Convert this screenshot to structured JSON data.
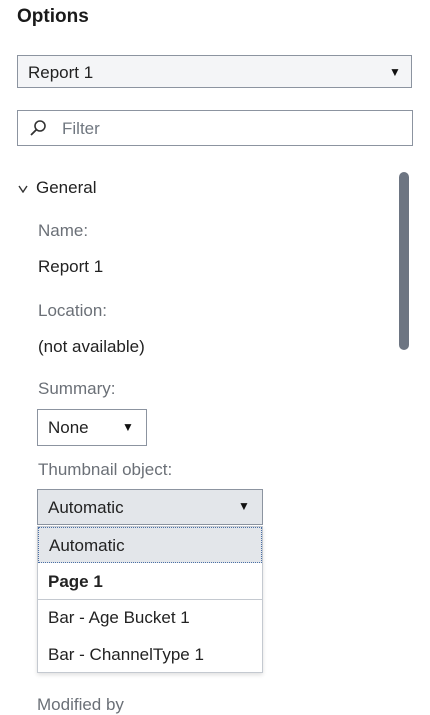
{
  "panel": {
    "title": "Options"
  },
  "report_select": {
    "value": "Report 1"
  },
  "filter": {
    "placeholder": "Filter"
  },
  "general": {
    "header": "General",
    "name_label": "Name:",
    "name_value": "Report 1",
    "location_label": "Location:",
    "location_value": "(not available)",
    "summary_label": "Summary:",
    "summary_value": "None",
    "thumbnail_label": "Thumbnail object:",
    "thumbnail_value": "Automatic",
    "thumbnail_options": [
      "Automatic",
      "Page 1",
      "Bar - Age Bucket 1",
      "Bar - ChannelType 1"
    ],
    "modified_label_partial": "Modified by"
  },
  "icons": {
    "caret": "▼",
    "chevron": "v"
  }
}
